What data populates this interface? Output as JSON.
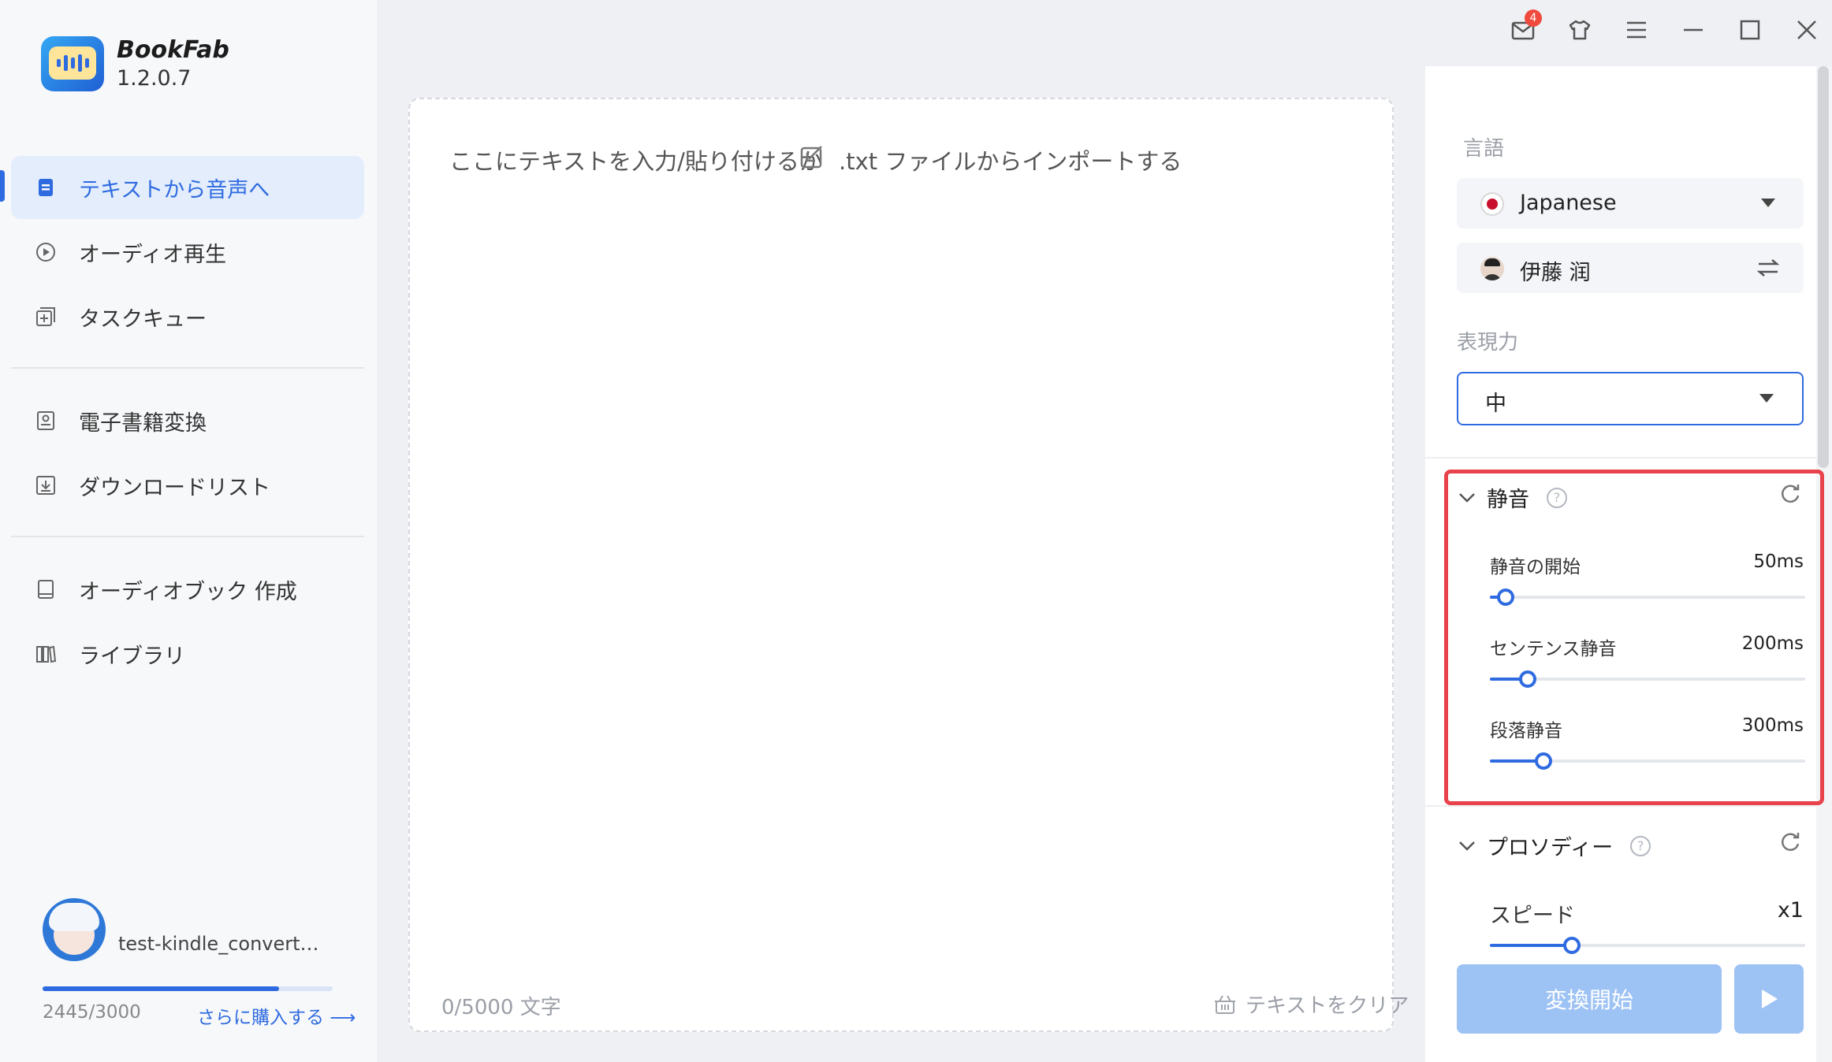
{
  "app": {
    "name": "BookFab",
    "version": "1.2.0.7"
  },
  "sidebar": {
    "items": [
      {
        "label": "テキストから音声へ",
        "active": true
      },
      {
        "label": "オーディオ再生"
      },
      {
        "label": "タスクキュー"
      },
      {
        "label": "電子書籍変換"
      },
      {
        "label": "ダウンロードリスト"
      },
      {
        "label": "オーディオブック 作成"
      },
      {
        "label": "ライブラリ"
      }
    ],
    "user": {
      "name": "test-kindle_converter...",
      "quota_text": "2445/3000",
      "quota_used_fraction": 0.815,
      "buy_label": "さらに購入する ⟶"
    }
  },
  "topbar": {
    "mail_badge": "4"
  },
  "editor": {
    "placeholder": "ここにテキストを入力/貼り付けるか",
    "import_label": ".txt ファイルからインポートする",
    "char_count": "0/5000 文字",
    "clear_label": "テキストをクリア"
  },
  "panel": {
    "language_label": "言語",
    "language_value": "Japanese",
    "voice_name": "伊藤 润",
    "expressiveness_label": "表現力",
    "expressiveness_value": "中",
    "silence": {
      "title": "静音",
      "sliders": [
        {
          "label": "静音の開始",
          "value": "50ms",
          "fraction": 0.05
        },
        {
          "label": "センテンス静音",
          "value": "200ms",
          "fraction": 0.12
        },
        {
          "label": "段落静音",
          "value": "300ms",
          "fraction": 0.17
        }
      ]
    },
    "prosody": {
      "title": "プロソディー",
      "sliders": [
        {
          "label": "スピード",
          "value": "x1",
          "fraction": 0.26
        }
      ]
    },
    "convert_label": "変換開始"
  },
  "colors": {
    "accent": "#2f6be0",
    "highlight_border": "#e8424b",
    "button_disabled": "#9dc2f4",
    "active_nav_bg": "#e3edfc"
  }
}
